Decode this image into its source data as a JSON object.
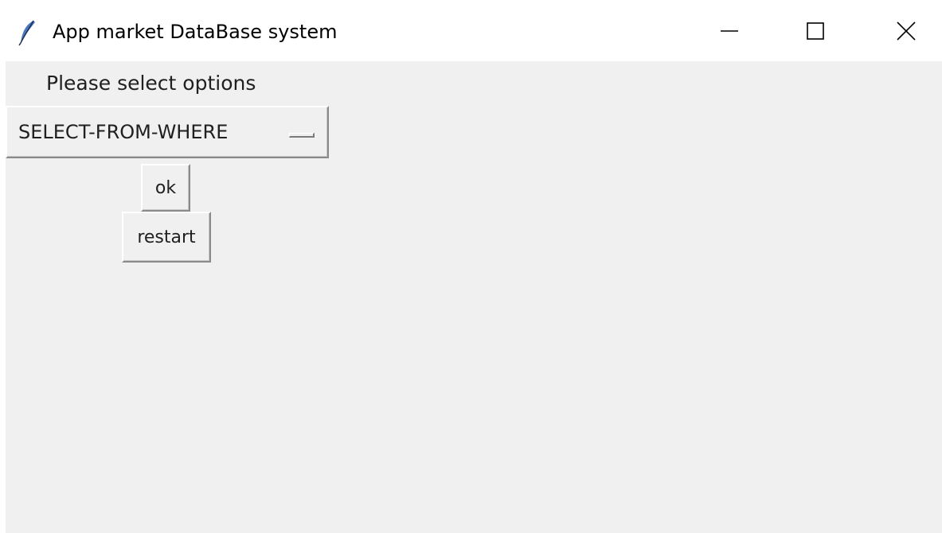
{
  "window": {
    "title": "App market DataBase system",
    "app_icon": "tk-feather-icon",
    "controls": {
      "minimize_icon": "minimize-icon",
      "maximize_icon": "maximize-icon",
      "close_icon": "close-icon"
    }
  },
  "main": {
    "prompt_label": "Please select options",
    "option_menu": {
      "selected_value": "SELECT-FROM-WHERE"
    },
    "buttons": {
      "ok_label": "ok",
      "restart_label": "restart"
    }
  },
  "colors": {
    "client_background": "#f0f0f0",
    "titlebar_background": "#ffffff",
    "text": "#202020"
  }
}
